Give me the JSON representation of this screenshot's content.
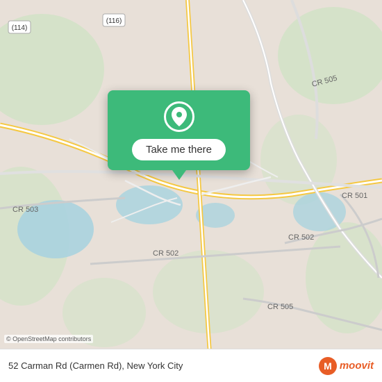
{
  "map": {
    "alt": "Map of New Jersey showing 52 Carman Rd area"
  },
  "tooltip": {
    "button_label": "Take me there"
  },
  "bottom_bar": {
    "address": "52 Carman Rd (Carmen Rd), New York City"
  },
  "attribution": {
    "text": "© OpenStreetMap contributors"
  },
  "moovit": {
    "wordmark": "moovit"
  },
  "icons": {
    "location_pin": "location-pin-icon",
    "moovit_logo": "moovit-logo-icon"
  },
  "colors": {
    "green": "#3dba7a",
    "white": "#ffffff",
    "road_major": "#f5c842",
    "road_minor": "#ffffff",
    "water": "#aad3df",
    "land": "#e8e0d8",
    "park": "#c8e6c9",
    "osm_orange": "#e85d26"
  }
}
